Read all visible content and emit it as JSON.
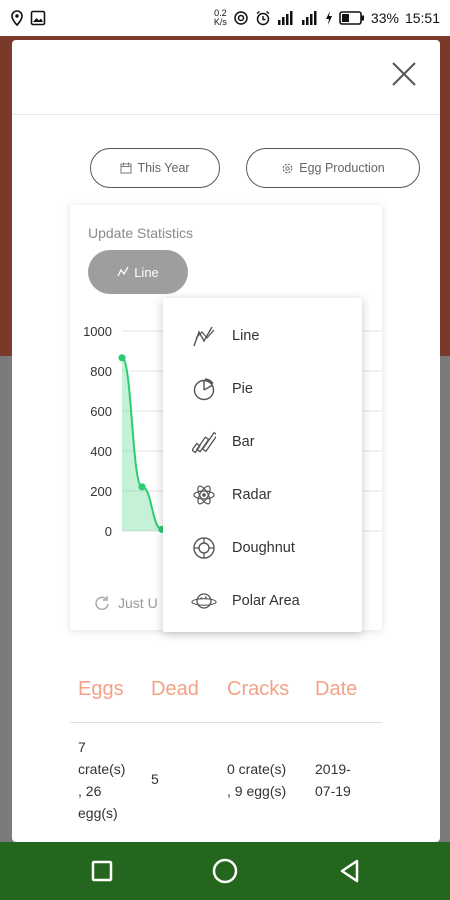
{
  "status_bar": {
    "net_speed_value": "0.2",
    "net_speed_unit": "K/s",
    "battery": "33%",
    "time": "15:51"
  },
  "filters": {
    "period": "This Year",
    "metric": "Egg Production"
  },
  "chart_card": {
    "title": "Update Statistics",
    "type_button": "Line",
    "updated_text": "Just U"
  },
  "dropdown": {
    "items": [
      {
        "label": "Line",
        "icon": "line-chart-icon"
      },
      {
        "label": "Pie",
        "icon": "pie-chart-icon"
      },
      {
        "label": "Bar",
        "icon": "bar-chart-icon"
      },
      {
        "label": "Radar",
        "icon": "radar-icon"
      },
      {
        "label": "Doughnut",
        "icon": "doughnut-icon"
      },
      {
        "label": "Polar Area",
        "icon": "polar-area-icon"
      }
    ]
  },
  "chart_data": {
    "type": "line",
    "y_ticks": [
      "1000",
      "800",
      "600",
      "400",
      "200",
      "0"
    ],
    "ylim": [
      0,
      1000
    ],
    "series": [
      {
        "values": [
          866,
          221,
          8,
          8,
          8,
          8,
          8,
          8,
          8,
          8,
          8,
          8
        ],
        "color": "#2ecc71"
      }
    ],
    "grid": true
  },
  "table": {
    "headers": [
      "Eggs",
      "Dead",
      "Cracks",
      "Date"
    ],
    "rows": [
      {
        "eggs_lines": [
          "7",
          "crate(s)",
          ", 26",
          "egg(s)"
        ],
        "dead": "5",
        "cracks_lines": [
          "0 crate(s)",
          ", 9 egg(s)"
        ],
        "date_lines": [
          "2019-",
          "07-19"
        ]
      }
    ]
  },
  "colors": {
    "accent_green": "#2ecc71",
    "header_salmon": "#f4a187",
    "nav_bar": "#24661e",
    "bg_top": "#7a3a2a"
  }
}
